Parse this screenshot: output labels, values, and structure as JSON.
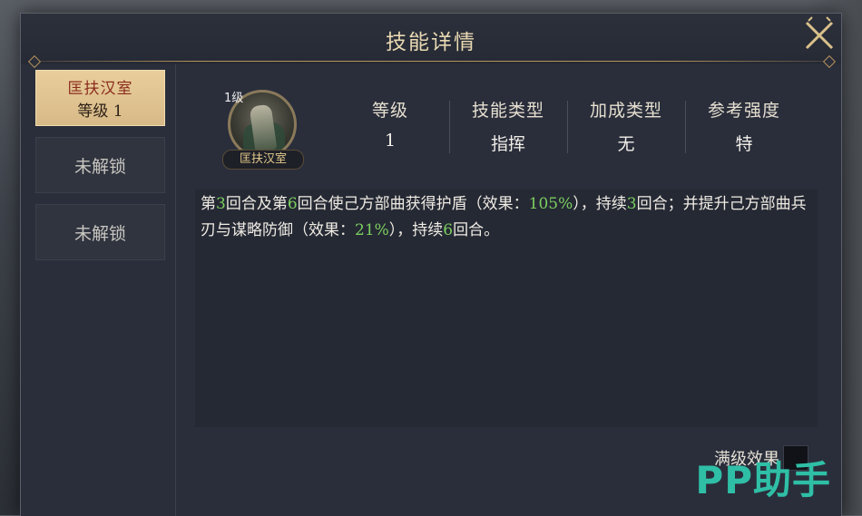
{
  "dialog": {
    "title": "技能详情"
  },
  "sidebar": {
    "items": [
      {
        "label": "匡扶汉室",
        "sub": "等级 1",
        "active": true
      },
      {
        "label": "未解锁"
      },
      {
        "label": "未解锁"
      }
    ]
  },
  "skill": {
    "level_badge": "1级",
    "name": "匡扶汉室",
    "stats": [
      {
        "key": "等级",
        "value": "1"
      },
      {
        "key": "技能类型",
        "value": "指挥"
      },
      {
        "key": "加成类型",
        "value": "无"
      },
      {
        "key": "参考强度",
        "value": "特"
      }
    ],
    "description": {
      "p1": "第",
      "n1": "3",
      "p2": "回合及第",
      "n2": "6",
      "p3": "回合使己方部曲获得护盾（效果：",
      "n3": "105%",
      "p4": "），持续",
      "n4": "3",
      "p5": "回合；并提升己方部曲兵刃与谋略防御（效果：",
      "n5": "21%",
      "p6": "），持续",
      "n6": "6",
      "p7": "回合。"
    }
  },
  "max_level": {
    "label": "满级效果"
  },
  "watermark": {
    "text": "PP助手"
  },
  "colors": {
    "accent": "#d7b987",
    "highlight_number": "#7ccf60",
    "watermark": "#2fbfa6"
  }
}
